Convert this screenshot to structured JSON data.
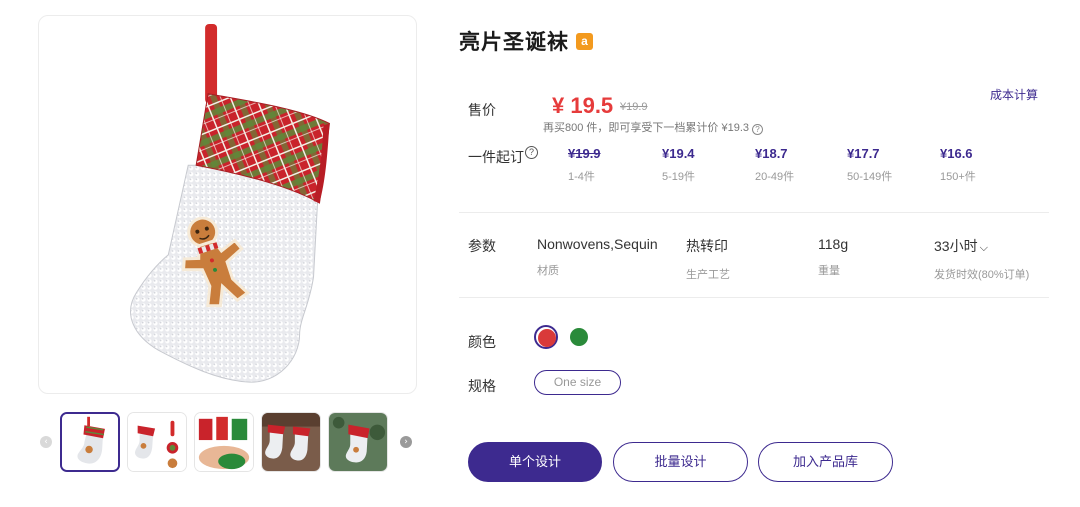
{
  "product": {
    "title": "亮片圣诞袜",
    "badge_letter": "a",
    "badge_color": "#f39a1e"
  },
  "pricing": {
    "cost_link": "成本计算",
    "sale_label": "售价",
    "price": "¥ 19.5",
    "original_price": "¥19.9",
    "bulk_note": "再买800 件，即可享受下一档累计价 ¥19.3",
    "moq_label": "一件起订",
    "tiers": [
      {
        "price": "¥19.9",
        "qty": "1-4件",
        "strikethrough": true
      },
      {
        "price": "¥19.4",
        "qty": "5-19件",
        "strikethrough": false
      },
      {
        "price": "¥18.7",
        "qty": "20-49件",
        "strikethrough": false
      },
      {
        "price": "¥17.7",
        "qty": "50-149件",
        "strikethrough": false
      },
      {
        "price": "¥16.6",
        "qty": "150+件",
        "strikethrough": false
      }
    ]
  },
  "params": {
    "label": "参数",
    "items": [
      {
        "value": "Nonwovens,Sequin",
        "key": "材质"
      },
      {
        "value": "热转印",
        "key": "生产工艺"
      },
      {
        "value": "118g",
        "key": "重量"
      },
      {
        "value": "33小时",
        "key": "发货时效(80%订单)"
      }
    ]
  },
  "options": {
    "color_label": "颜色",
    "colors": [
      {
        "name": "red",
        "hex": "#d93a3a",
        "selected": true
      },
      {
        "name": "green",
        "hex": "#2a8a3a",
        "selected": false
      }
    ],
    "size_label": "规格",
    "size_value": "One size"
  },
  "actions": {
    "single_design": "单个设计",
    "batch_design": "批量设计",
    "add_to_library": "加入产品库"
  },
  "gallery": {
    "thumb_count": 5,
    "active_index": 0
  },
  "colors": {
    "accent": "#3d2a8f",
    "price_red": "#e63b3b"
  }
}
